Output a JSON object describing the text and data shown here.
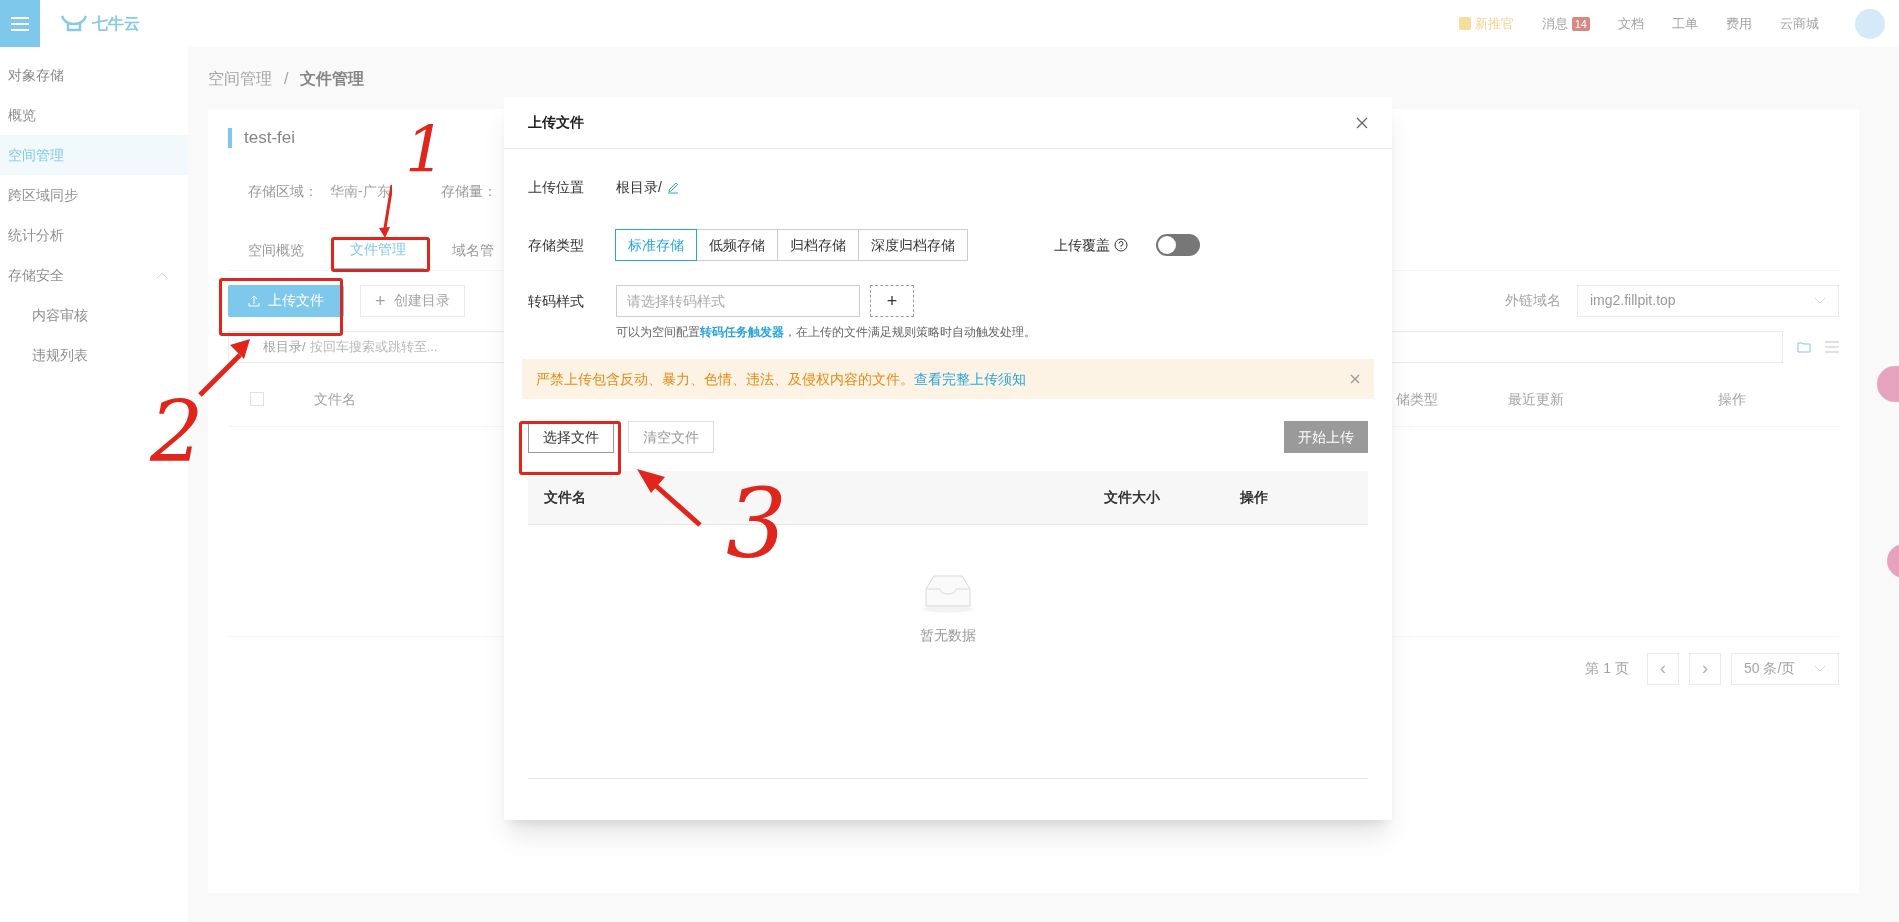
{
  "topbar": {
    "logo": "七牛云",
    "links": [
      {
        "label": "新推官",
        "kind": "gift"
      },
      {
        "label": "消息",
        "kind": "badge",
        "badge": "14"
      },
      {
        "label": "文档",
        "kind": "plain"
      },
      {
        "label": "工单",
        "kind": "plain"
      },
      {
        "label": "费用",
        "kind": "plain"
      },
      {
        "label": "云商城",
        "kind": "plain"
      }
    ]
  },
  "sidebar": {
    "title": "对象存储",
    "items": [
      {
        "label": "概览",
        "selected": false
      },
      {
        "label": "空间管理",
        "selected": true
      },
      {
        "label": "跨区域同步",
        "selected": false
      },
      {
        "label": "统计分析",
        "selected": false
      },
      {
        "label": "存储安全",
        "selected": false,
        "expanded": true,
        "children": [
          {
            "label": "内容审核",
            "selected": false
          },
          {
            "label": "违规列表",
            "selected": false
          }
        ]
      }
    ]
  },
  "breadcrumb": [
    "空间管理",
    "/",
    "文件管理"
  ],
  "bucket": {
    "name": "test-fei",
    "info": [
      {
        "label": "存储区域：",
        "value": "华南-广东"
      },
      {
        "label": "存储量："
      }
    ]
  },
  "tabs": [
    {
      "label": "空间概览",
      "selected": false
    },
    {
      "label": "文件管理",
      "selected": true
    },
    {
      "label": "域名管",
      "selected": false
    }
  ],
  "toolbar": {
    "upload": "上传文件",
    "mkdir": "创建目录",
    "mkdir_icon": "+",
    "domain_label": "外链域名",
    "domain": "img2.fillpit.top"
  },
  "pathbar": {
    "prefix": "根目录/",
    "placeholder": "按回车搜索或跳转至..."
  },
  "table": {
    "select_all": {
      "checked": false
    },
    "columns": [
      "文件名",
      "储类型",
      "最近更新",
      "操作"
    ]
  },
  "pagination": {
    "page": "第 1 页",
    "prev": "‹",
    "next": "›",
    "page_size": "50 条/页"
  },
  "modal": {
    "title": "上传文件",
    "location": {
      "label": "上传位置",
      "value": "根目录/"
    },
    "storage": {
      "label": "存储类型",
      "options": [
        {
          "label": "标准存储",
          "selected": true
        },
        {
          "label": "低频存储",
          "selected": false
        },
        {
          "label": "归档存储",
          "selected": false
        },
        {
          "label": "深度归档存储",
          "selected": false
        }
      ]
    },
    "overwrite": {
      "label": "上传覆盖",
      "on": false
    },
    "transcode": {
      "label": "转码样式",
      "placeholder": "请选择转码样式",
      "add": "+",
      "hint": "可以为空间配置**转码任务触发器**，在上传的文件满足规则策略时自动触发处理。"
    },
    "alert": {
      "text": "严禁上传包含反动、暴力、色情、违法、及侵权内容的文件。",
      "link": "查看完整上传须知"
    },
    "buttons": [
      {
        "label": "选择文件",
        "disabled": false
      },
      {
        "label": "清空文件",
        "disabled": true
      },
      {
        "label": "开始上传",
        "disabled": true
      }
    ],
    "columns": [
      "文件名",
      "文件大小",
      "操作"
    ],
    "empty": "暂无数据"
  },
  "annotations": [
    {
      "label": "1"
    },
    {
      "label": "2"
    },
    {
      "label": "3"
    }
  ]
}
